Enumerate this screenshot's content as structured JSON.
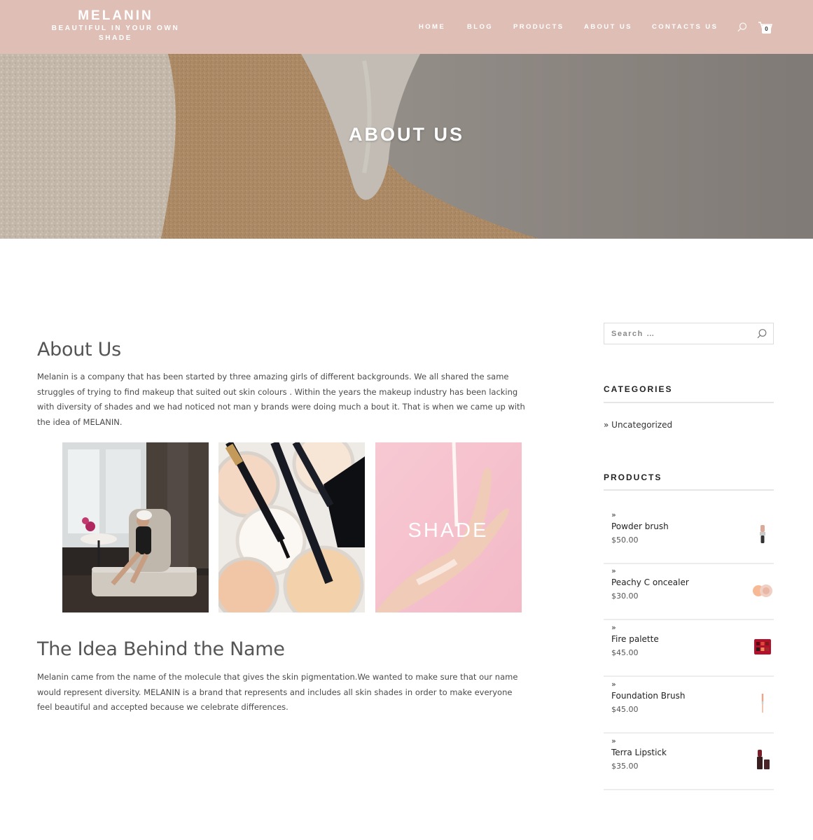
{
  "site": {
    "title": "MELANIN",
    "tagline_line1": "BEAUTIFUL IN YOUR OWN",
    "tagline_line2": "SHADE"
  },
  "nav": {
    "items": [
      {
        "label": "HOME"
      },
      {
        "label": "BLOG"
      },
      {
        "label": "PRODUCTS"
      },
      {
        "label": "ABOUT US"
      },
      {
        "label": "CONTACTS US"
      }
    ],
    "cart_count": "0"
  },
  "hero": {
    "title": "ABOUT US"
  },
  "main": {
    "about_heading": "About Us",
    "about_text": "Melanin is a company that has been started by three amazing girls of different backgrounds. We all shared the same struggles of trying to find makeup that suited out skin colours . Within the years the makeup industry has been lacking with diversity of shades and we had noticed not man y brands were doing much a bout it. That is when we came up with the idea of MELANIN.",
    "image3_text": "SHADE",
    "idea_heading": "The Idea Behind the Name",
    "idea_text": "Melanin came from the name of the molecule that gives the skin pigmentation.We wanted to make sure that our name would represent diversity. MELANIN is a brand that represents and includes all skin shades in order to make everyone feel beautiful and accepted because we celebrate differences."
  },
  "sidebar": {
    "search_placeholder": "Search …",
    "categories_title": "CATEGORIES",
    "categories": [
      {
        "label": "» Uncategorized"
      }
    ],
    "products_title": "PRODUCTS",
    "products": [
      {
        "name": "Powder brush",
        "price": "$50.00"
      },
      {
        "name": "Peachy C oncealer",
        "price": "$30.00"
      },
      {
        "name": "Fire palette",
        "price": "$45.00"
      },
      {
        "name": "Foundation Brush",
        "price": "$45.00"
      },
      {
        "name": "Terra Lipstick",
        "price": "$35.00"
      }
    ],
    "raquo": "»"
  },
  "colors": {
    "header_bg": "#dfbfb5",
    "accent": "#ffffff"
  }
}
